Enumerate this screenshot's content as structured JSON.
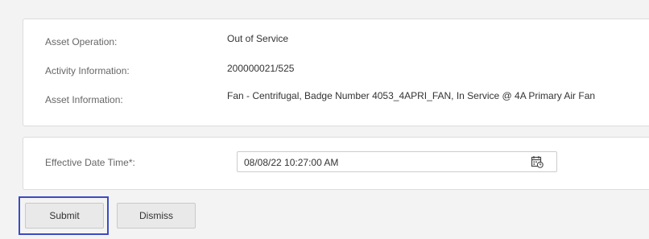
{
  "asset_details": {
    "asset_operation_label": "Asset Operation:",
    "asset_operation_value": "Out of Service",
    "activity_information_label": "Activity Information:",
    "activity_information_value": "200000021/525",
    "asset_information_label": "Asset Information:",
    "asset_information_value": "Fan - Centrifugal, Badge Number 4053_4APRI_FAN, In Service @ 4A Primary Air Fan"
  },
  "effective_date": {
    "label": "Effective Date Time*:",
    "value": "08/08/22 10:27:00 AM",
    "icon": "calendar-clock-icon"
  },
  "actions": {
    "submit_label": "Submit",
    "dismiss_label": "Dismiss",
    "focused": "submit"
  },
  "colors": {
    "background": "#f3f3f3",
    "focus_ring": "#3b4bc4",
    "button_bg": "#e9e9e9"
  }
}
